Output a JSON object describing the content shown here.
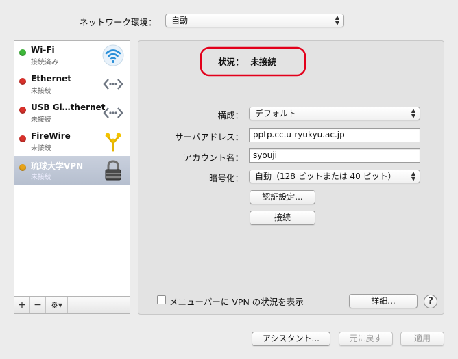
{
  "location": {
    "label": "ネットワーク環境：",
    "value": "自動"
  },
  "services": [
    {
      "name": "Wi-Fi",
      "status": "接続済み",
      "dot_color": "#3fb93a",
      "icon": "wifi-icon"
    },
    {
      "name": "Ethernet",
      "status": "未接続",
      "dot_color": "#d9312b",
      "icon": "ethernet-icon"
    },
    {
      "name": "USB Gi…thernet",
      "status": "未接続",
      "dot_color": "#d9312b",
      "icon": "ethernet-icon"
    },
    {
      "name": "FireWire",
      "status": "未接続",
      "dot_color": "#d9312b",
      "icon": "firewire-icon"
    },
    {
      "name": "琉球大学VPN",
      "status": "未接続",
      "dot_color": "#e8a318",
      "icon": "vpn-lock-icon",
      "selected": true
    }
  ],
  "sidebar_toolbar": {
    "add": "+",
    "remove": "−",
    "action": "⚙▾"
  },
  "detail": {
    "status_label": "状況：",
    "status_value": "未接続",
    "config_label": "構成：",
    "config_value": "デフォルト",
    "server_label": "サーバアドレス：",
    "server_value": "pptp.cc.u-ryukyu.ac.jp",
    "account_label": "アカウント名：",
    "account_value": "syouji",
    "encryption_label": "暗号化：",
    "encryption_value": "自動（128 ビットまたは 40 ビット）",
    "auth_button": "認証設定...",
    "connect_button": "接続",
    "menu_checkbox_label": "メニューバーに VPN の状況を表示",
    "menu_checkbox_checked": false,
    "advanced_button": "詳細...",
    "help": "?"
  },
  "footer": {
    "assistant_button": "アシスタント...",
    "revert_button": "元に戻す",
    "apply_button": "適用"
  },
  "colors": {
    "annotation": "#e3001b",
    "selected_row": "#b6bfcf"
  }
}
